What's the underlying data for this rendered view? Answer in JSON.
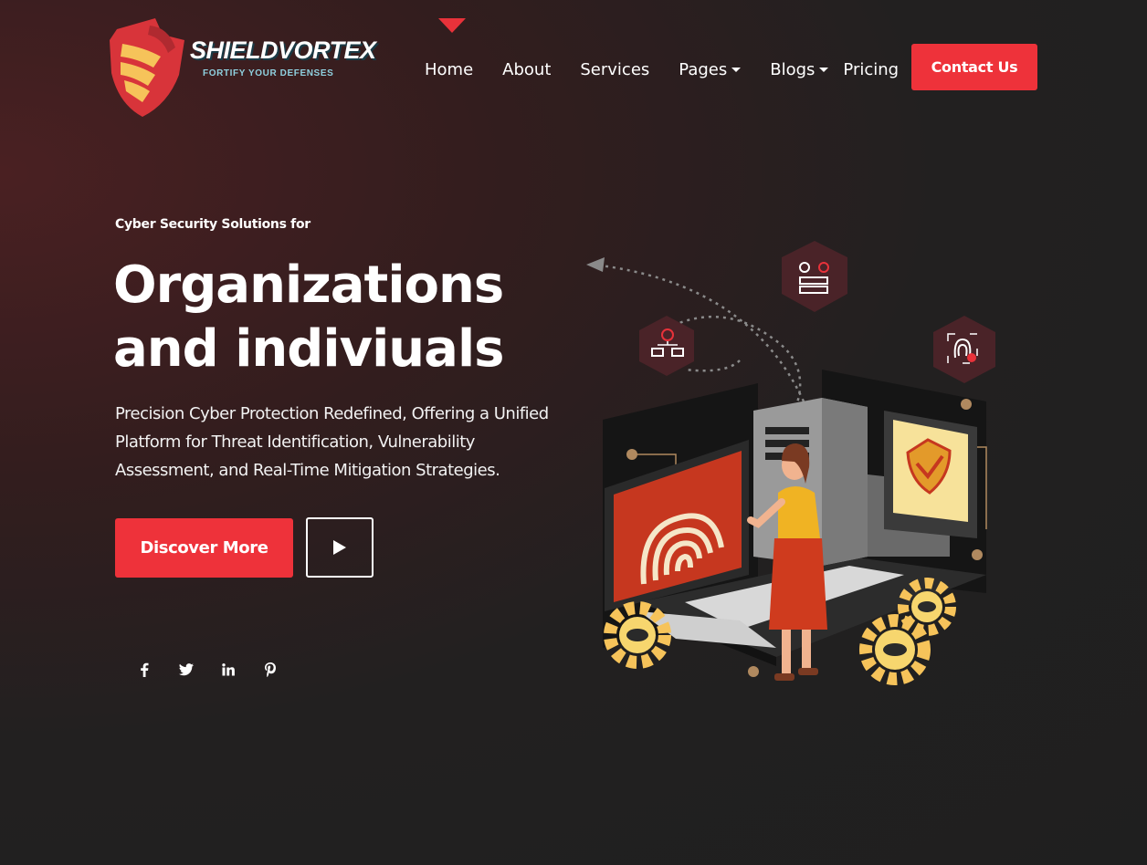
{
  "brand": {
    "name": "SHIELDVORTEX",
    "tagline": "FORTIFY YOUR DEFENSES",
    "colors": {
      "accent": "#ee323a",
      "shield_gold": "#f6c35a",
      "tagline": "#8fd0df"
    }
  },
  "nav": {
    "items": [
      {
        "label": "Home",
        "active": true
      },
      {
        "label": "About"
      },
      {
        "label": "Services"
      },
      {
        "label": "Pages",
        "dropdown": true
      },
      {
        "label": "Blogs",
        "dropdown": true
      },
      {
        "label": "Pricing"
      }
    ],
    "cta_label": "Contact Us"
  },
  "hero": {
    "eyebrow": "Cyber Security Solutions for",
    "title_line1": "Organizations",
    "title_line2": "and indiviuals",
    "description": "Precision Cyber Protection Redefined, Offering a Unified Platform for Threat Identification, Vulnerability Assessment, and Real-Time Mitigation Strategies.",
    "primary_button": "Discover More",
    "play_icon": "play-icon"
  },
  "socials": [
    {
      "icon": "facebook-icon"
    },
    {
      "icon": "twitter-icon"
    },
    {
      "icon": "linkedin-icon"
    },
    {
      "icon": "pinterest-icon"
    }
  ],
  "illustration": {
    "icons": [
      "network-skull-icon",
      "server-bug-icon",
      "fingerprint-bug-icon",
      "shield-check-icon",
      "fingerprint-icon",
      "gear-icon"
    ]
  }
}
